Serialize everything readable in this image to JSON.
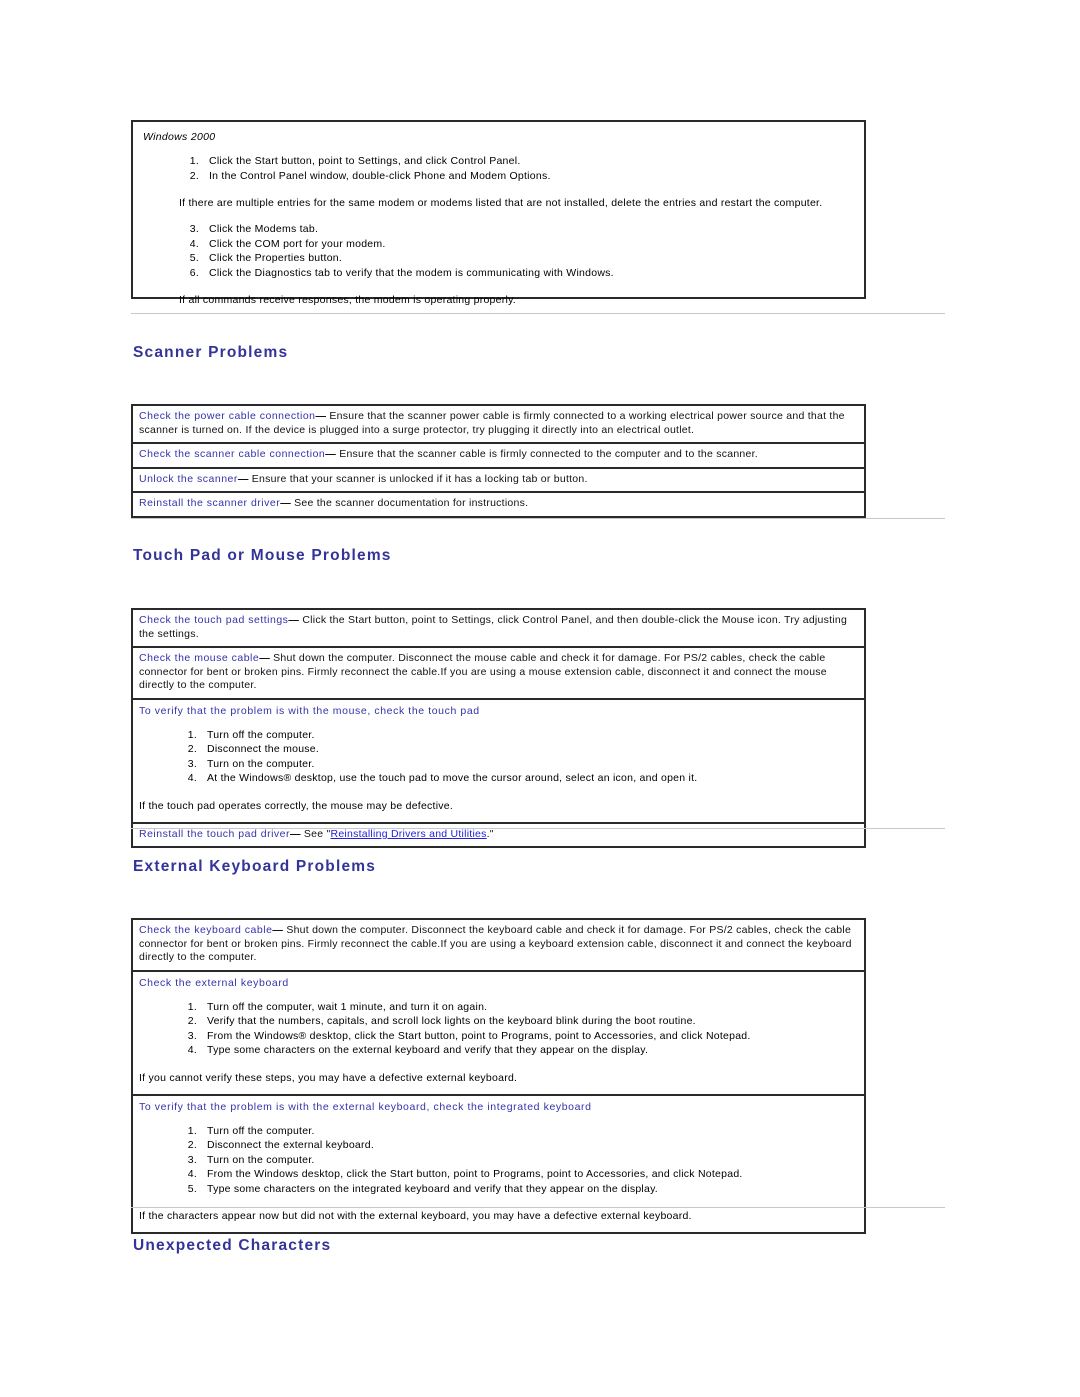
{
  "colors": {
    "heading": "#333399",
    "lead_in": "#3333aa",
    "link": "#2020dd",
    "rule": "#c8c8c8",
    "table_border": "#2a2a2a"
  },
  "windows_panel": {
    "os_title": "Windows 2000",
    "steps_a": [
      "Click the Start button, point to Settings, and click Control Panel.",
      "In the Control Panel window, double-click Phone and Modem Options."
    ],
    "note_a": "If there are multiple entries for the same modem or modems listed that are not installed, delete the entries and restart the computer.",
    "steps_b": [
      "Click the Modems tab.",
      "Click the COM port for your modem.",
      "Click the Properties button.",
      "Click the Diagnostics tab to verify that the modem is communicating with Windows."
    ],
    "note_b": "If all commands receive responses, the modem is operating properly."
  },
  "scanner": {
    "heading": "Scanner Problems",
    "rows": [
      {
        "lead": "Check the power cable connection",
        "dash": "—",
        "text": " Ensure that the scanner power cable is firmly connected to a working electrical power source and that the scanner is turned on. If the device is plugged into a surge protector, try plugging it directly into an electrical outlet."
      },
      {
        "lead": "Check the scanner cable connection",
        "dash": "—",
        "text": " Ensure that the scanner cable is firmly connected to the computer and to the scanner."
      },
      {
        "lead": "Unlock the scanner",
        "dash": "—",
        "text": " Ensure that your scanner is unlocked if it has a locking tab or button."
      },
      {
        "lead": "Reinstall the scanner driver",
        "dash": "—",
        "text": " See the scanner documentation for instructions."
      }
    ]
  },
  "touchpad": {
    "heading": "Touch Pad or Mouse Problems",
    "row1_lead": "Check the touch pad settings",
    "row1_dash": "—",
    "row1_text": " Click the Start button, point to Settings, click Control Panel, and then double-click the Mouse icon. Try adjusting the settings.",
    "row2_lead": "Check the mouse cable",
    "row2_dash": "—",
    "row2_text": " Shut down the computer. Disconnect the mouse cable and check it for damage. For PS/2 cables, check the cable connector for bent or broken pins. Firmly reconnect the cable.If you are using a mouse extension cable, disconnect it and connect the mouse directly to the computer.",
    "row3_heading": "To verify that the problem is with the mouse, check the touch pad",
    "row3_steps": [
      "Turn off the computer.",
      "Disconnect the mouse.",
      "Turn on the computer.",
      "At the Windows® desktop, use the touch pad to move the cursor around, select an icon, and open it."
    ],
    "row3_note": "If the touch pad operates correctly, the mouse may be defective.",
    "row4_lead": "Reinstall the touch pad driver",
    "row4_dash": "—",
    "row4_text_before": " See \"",
    "row4_link": "Reinstalling Drivers and Utilities",
    "row4_text_after": ".\""
  },
  "keyboard": {
    "heading": "External Keyboard Problems",
    "row1_lead": "Check the keyboard cable",
    "row1_dash": "—",
    "row1_text": " Shut down the computer. Disconnect the keyboard cable and check it for damage. For PS/2 cables, check the cable connector for bent or broken pins. Firmly reconnect the cable.If you are using a keyboard extension cable, disconnect it and connect the keyboard directly to the computer.",
    "row2_heading": "Check the external keyboard",
    "row2_steps": [
      "Turn off the computer, wait 1 minute, and turn it on again.",
      "Verify that the numbers, capitals, and scroll lock lights on the keyboard blink during the boot routine.",
      "From the Windows® desktop, click the Start button, point to Programs, point to Accessories, and click Notepad.",
      "Type some characters on the external keyboard and verify that they appear on the display."
    ],
    "row2_note": "If you cannot verify these steps, you may have a defective external keyboard.",
    "row3_heading": "To verify that the problem is with the external keyboard, check the integrated keyboard",
    "row3_steps": [
      "Turn off the computer.",
      "Disconnect the external keyboard.",
      "Turn on the computer.",
      "From the Windows desktop, click the Start button, point to Programs, point to Accessories, and click Notepad.",
      "Type some characters on the integrated keyboard and verify that they appear on the display."
    ],
    "row3_note": "If the characters appear now but did not with the external keyboard, you may have a defective external keyboard."
  },
  "unexpected": {
    "heading": "Unexpected Characters"
  }
}
